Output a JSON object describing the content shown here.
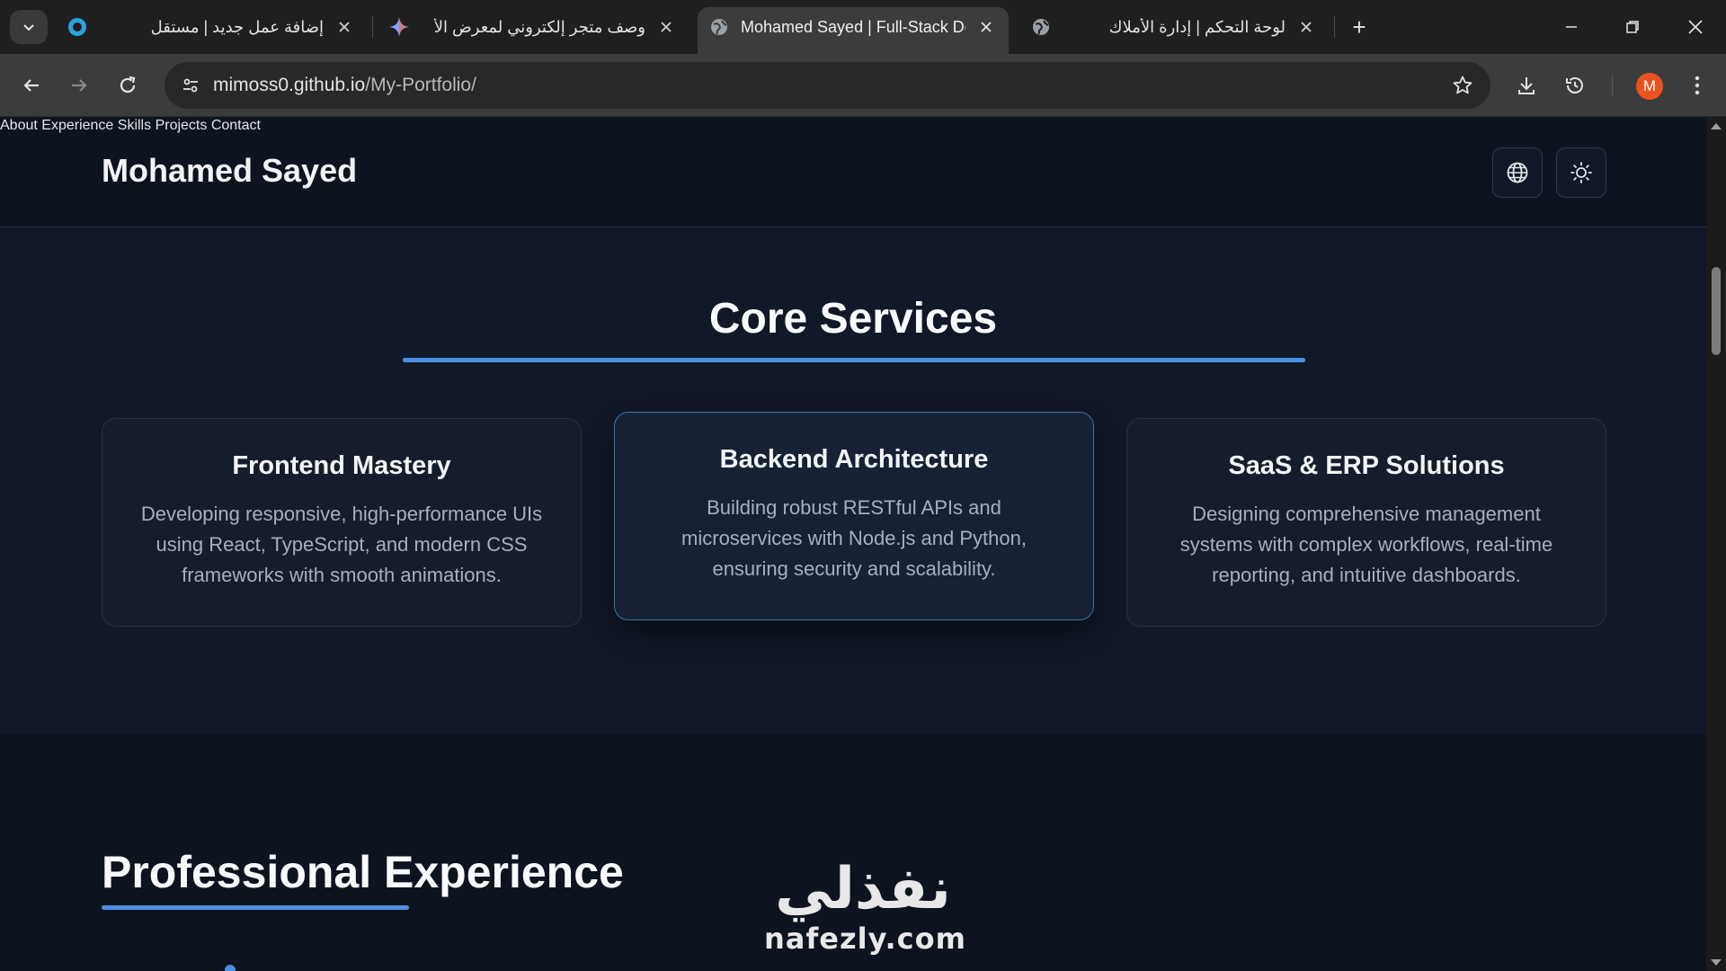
{
  "browser": {
    "tabs": [
      {
        "title": "إضافة عمل جديد | مستقل",
        "favicon": "mostaql-circle-icon",
        "active": false
      },
      {
        "title": "وصف متجر إلكتروني لمعرض الأ",
        "favicon": "gemini-sparkle-icon",
        "active": false
      },
      {
        "title": "Mohamed Sayed | Full-Stack De",
        "favicon": "globe-icon",
        "active": true
      },
      {
        "title": "لوحة التحكم | إدارة الأملاك",
        "favicon": "globe-icon",
        "active": false
      }
    ],
    "new_tab_label": "+",
    "url_host": "mimoss0.github.io",
    "url_path": "/My-Portfolio/",
    "profile_initial": "M",
    "profile_color": "#e8531f"
  },
  "site": {
    "logo": "Mohamed Sayed",
    "nav": [
      "About",
      "Experience",
      "Skills",
      "Projects",
      "Contact"
    ],
    "accent_color": "#4a90e2"
  },
  "services": {
    "title": "Core Services",
    "cards": [
      {
        "title": "Frontend Mastery",
        "description": "Developing responsive, high-performance UIs using React, TypeScript, and modern CSS frameworks with smooth animations."
      },
      {
        "title": "Backend Architecture",
        "description": "Building robust RESTful APIs and microservices with Node.js and Python, ensuring security and scalability."
      },
      {
        "title": "SaaS & ERP Solutions",
        "description": "Designing comprehensive management systems with complex workflows, real-time reporting, and intuitive dashboards."
      }
    ]
  },
  "experience": {
    "title": "Professional Experience"
  },
  "watermark": {
    "arabic": "نفذلي",
    "latin": "nafezly.com"
  }
}
